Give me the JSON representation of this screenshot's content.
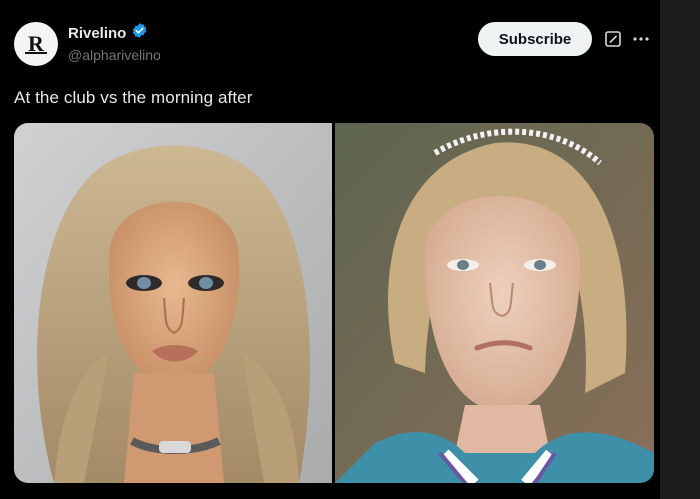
{
  "post": {
    "author": {
      "display_name": "Rivelino",
      "handle": "@alpharivelino",
      "avatar_letter": "R",
      "verified": true
    },
    "subscribe_label": "Subscribe",
    "text": "At the club vs the morning after",
    "media": [
      {
        "description_icon": "photo-glam-makeup"
      },
      {
        "description_icon": "photo-no-makeup"
      }
    ]
  },
  "colors": {
    "background": "#000000",
    "text_primary": "#e7e9ea",
    "text_secondary": "#71767b",
    "verified_badge": "#1d9bf0",
    "subscribe_bg": "#eff3f4"
  },
  "icons": [
    "verified-badge-icon",
    "grok-icon",
    "more-icon"
  ]
}
